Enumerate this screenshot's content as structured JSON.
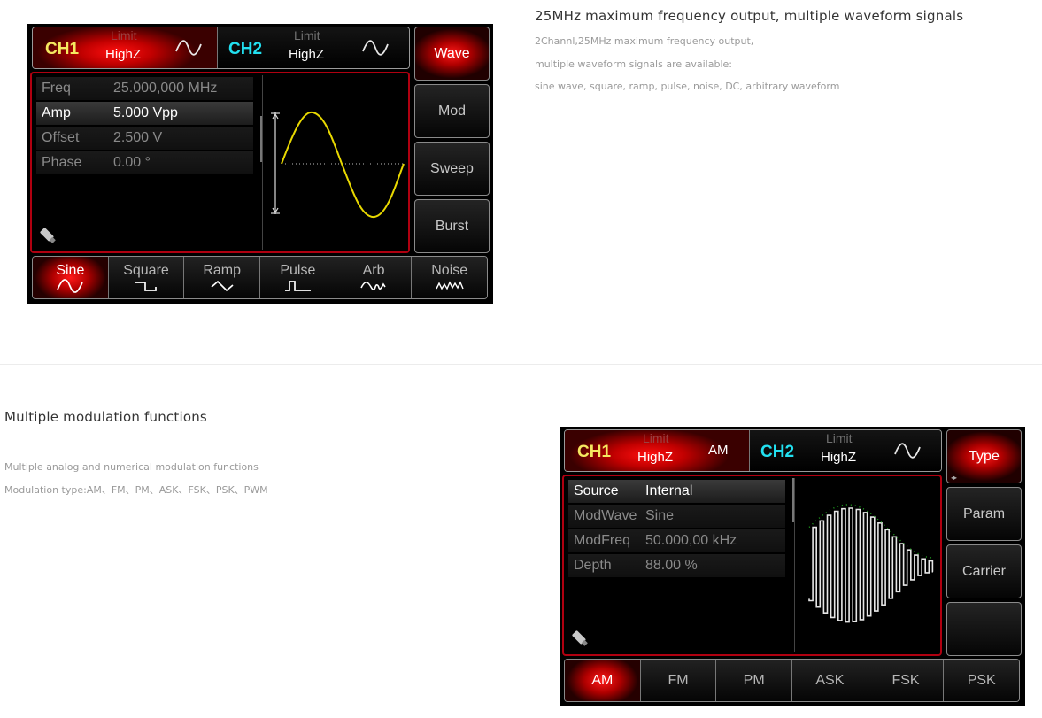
{
  "section1": {
    "title": "25MHz maximum frequency output, multiple waveform signals",
    "description": [
      "2Channl,25MHz maximum frequency output,",
      "multiple waveform signals are available:",
      "sine wave, square, ramp, pulse, noise, DC, arbitrary waveform"
    ],
    "screen": {
      "ch1": {
        "name": "CH1",
        "limit": "Limit",
        "load": "HighZ",
        "wave_icon": "sine-icon"
      },
      "ch2": {
        "name": "CH2",
        "limit": "Limit",
        "load": "HighZ",
        "wave_icon": "sine-icon"
      },
      "side_menu": [
        {
          "label": "Wave",
          "active": true
        },
        {
          "label": "Mod",
          "active": false
        },
        {
          "label": "Sweep",
          "active": false
        },
        {
          "label": "Burst",
          "active": false
        }
      ],
      "params": [
        {
          "label": "Freq",
          "value": "25.000,000 MHz",
          "active": false
        },
        {
          "label": "Amp",
          "value": "5.000 Vpp",
          "active": true
        },
        {
          "label": "Offset",
          "value": "2.500 V",
          "active": false
        },
        {
          "label": "Phase",
          "value": "0.00 °",
          "active": false
        }
      ],
      "tabs": [
        {
          "label": "Sine",
          "icon": "sine-icon",
          "active": true
        },
        {
          "label": "Square",
          "icon": "square-wave-icon",
          "active": false
        },
        {
          "label": "Ramp",
          "icon": "ramp-wave-icon",
          "active": false
        },
        {
          "label": "Pulse",
          "icon": "pulse-wave-icon",
          "active": false
        },
        {
          "label": "Arb",
          "icon": "arb-wave-icon",
          "active": false
        },
        {
          "label": "Noise",
          "icon": "noise-wave-icon",
          "active": false
        }
      ]
    }
  },
  "section2": {
    "title": "Multiple modulation functions",
    "description": [
      "Multiple analog and numerical modulation functions",
      "Modulation type:AM、FM、PM、ASK、FSK、PSK、PWM"
    ],
    "screen": {
      "ch1": {
        "name": "CH1",
        "limit": "Limit",
        "load": "HighZ",
        "mode": "AM"
      },
      "ch2": {
        "name": "CH2",
        "limit": "Limit",
        "load": "HighZ",
        "wave_icon": "sine-icon"
      },
      "side_menu": [
        {
          "label": "Type",
          "active": true,
          "arrows": "◂▸"
        },
        {
          "label": "Param",
          "active": false
        },
        {
          "label": "Carrier",
          "active": false
        },
        {
          "label": "",
          "active": false
        }
      ],
      "params": [
        {
          "label": "Source",
          "value": "Internal",
          "active": true
        },
        {
          "label": "ModWave",
          "value": "Sine",
          "active": false
        },
        {
          "label": "ModFreq",
          "value": "50.000,00 kHz",
          "active": false
        },
        {
          "label": "Depth",
          "value": "88.00 %",
          "active": false
        }
      ],
      "tabs": [
        {
          "label": "AM",
          "active": true
        },
        {
          "label": "FM",
          "active": false
        },
        {
          "label": "PM",
          "active": false
        },
        {
          "label": "ASK",
          "active": false
        },
        {
          "label": "FSK",
          "active": false
        },
        {
          "label": "PSK",
          "active": false
        }
      ]
    }
  },
  "colors": {
    "ch1": "#f5e860",
    "ch2": "#22e0f0",
    "active_red": "#ff1010",
    "waveform_yellow": "#e8d800",
    "envelope_green": "#1fa81f"
  }
}
